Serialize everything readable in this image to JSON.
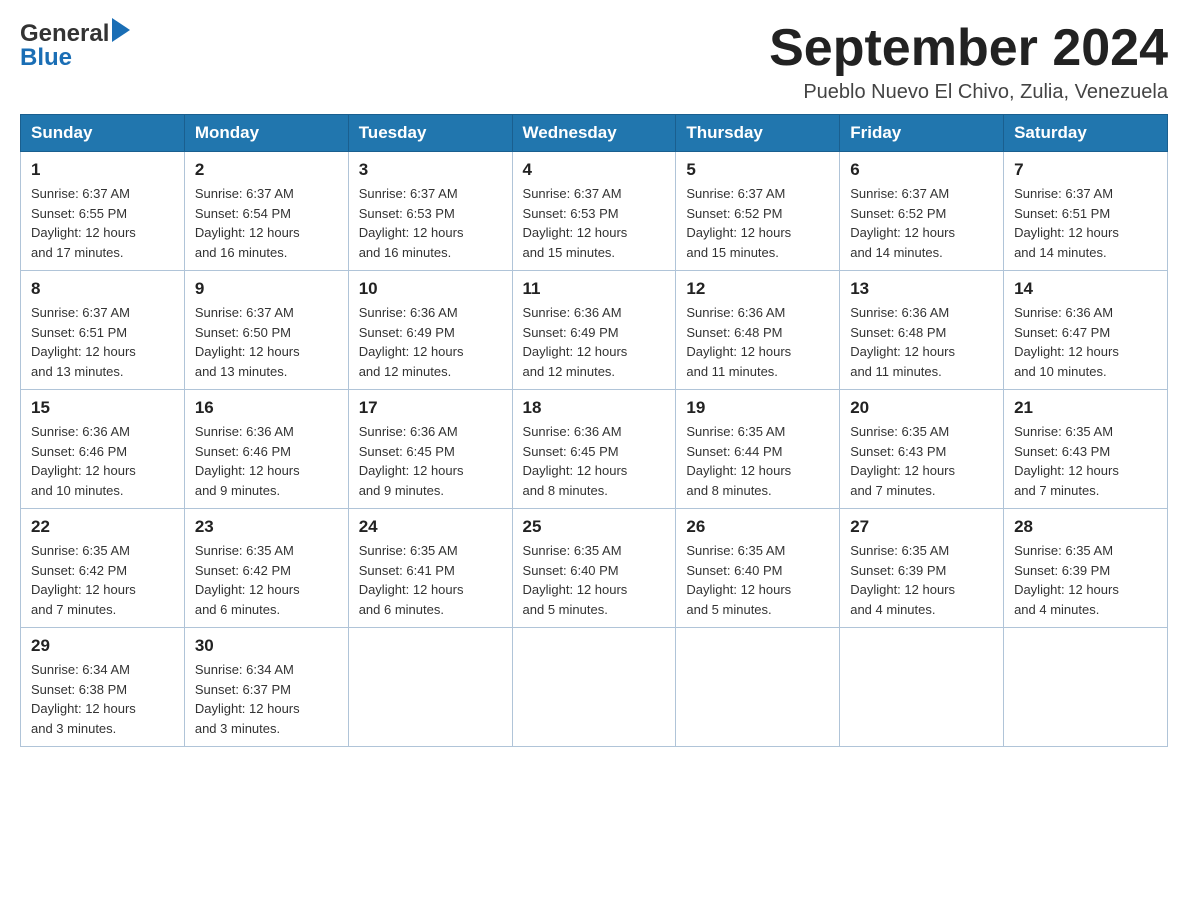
{
  "header": {
    "logo_general": "General",
    "logo_blue": "Blue",
    "title": "September 2024",
    "subtitle": "Pueblo Nuevo El Chivo, Zulia, Venezuela"
  },
  "columns": [
    "Sunday",
    "Monday",
    "Tuesday",
    "Wednesday",
    "Thursday",
    "Friday",
    "Saturday"
  ],
  "weeks": [
    [
      {
        "day": "1",
        "sunrise": "6:37 AM",
        "sunset": "6:55 PM",
        "daylight": "12 hours and 17 minutes."
      },
      {
        "day": "2",
        "sunrise": "6:37 AM",
        "sunset": "6:54 PM",
        "daylight": "12 hours and 16 minutes."
      },
      {
        "day": "3",
        "sunrise": "6:37 AM",
        "sunset": "6:53 PM",
        "daylight": "12 hours and 16 minutes."
      },
      {
        "day": "4",
        "sunrise": "6:37 AM",
        "sunset": "6:53 PM",
        "daylight": "12 hours and 15 minutes."
      },
      {
        "day": "5",
        "sunrise": "6:37 AM",
        "sunset": "6:52 PM",
        "daylight": "12 hours and 15 minutes."
      },
      {
        "day": "6",
        "sunrise": "6:37 AM",
        "sunset": "6:52 PM",
        "daylight": "12 hours and 14 minutes."
      },
      {
        "day": "7",
        "sunrise": "6:37 AM",
        "sunset": "6:51 PM",
        "daylight": "12 hours and 14 minutes."
      }
    ],
    [
      {
        "day": "8",
        "sunrise": "6:37 AM",
        "sunset": "6:51 PM",
        "daylight": "12 hours and 13 minutes."
      },
      {
        "day": "9",
        "sunrise": "6:37 AM",
        "sunset": "6:50 PM",
        "daylight": "12 hours and 13 minutes."
      },
      {
        "day": "10",
        "sunrise": "6:36 AM",
        "sunset": "6:49 PM",
        "daylight": "12 hours and 12 minutes."
      },
      {
        "day": "11",
        "sunrise": "6:36 AM",
        "sunset": "6:49 PM",
        "daylight": "12 hours and 12 minutes."
      },
      {
        "day": "12",
        "sunrise": "6:36 AM",
        "sunset": "6:48 PM",
        "daylight": "12 hours and 11 minutes."
      },
      {
        "day": "13",
        "sunrise": "6:36 AM",
        "sunset": "6:48 PM",
        "daylight": "12 hours and 11 minutes."
      },
      {
        "day": "14",
        "sunrise": "6:36 AM",
        "sunset": "6:47 PM",
        "daylight": "12 hours and 10 minutes."
      }
    ],
    [
      {
        "day": "15",
        "sunrise": "6:36 AM",
        "sunset": "6:46 PM",
        "daylight": "12 hours and 10 minutes."
      },
      {
        "day": "16",
        "sunrise": "6:36 AM",
        "sunset": "6:46 PM",
        "daylight": "12 hours and 9 minutes."
      },
      {
        "day": "17",
        "sunrise": "6:36 AM",
        "sunset": "6:45 PM",
        "daylight": "12 hours and 9 minutes."
      },
      {
        "day": "18",
        "sunrise": "6:36 AM",
        "sunset": "6:45 PM",
        "daylight": "12 hours and 8 minutes."
      },
      {
        "day": "19",
        "sunrise": "6:35 AM",
        "sunset": "6:44 PM",
        "daylight": "12 hours and 8 minutes."
      },
      {
        "day": "20",
        "sunrise": "6:35 AM",
        "sunset": "6:43 PM",
        "daylight": "12 hours and 7 minutes."
      },
      {
        "day": "21",
        "sunrise": "6:35 AM",
        "sunset": "6:43 PM",
        "daylight": "12 hours and 7 minutes."
      }
    ],
    [
      {
        "day": "22",
        "sunrise": "6:35 AM",
        "sunset": "6:42 PM",
        "daylight": "12 hours and 7 minutes."
      },
      {
        "day": "23",
        "sunrise": "6:35 AM",
        "sunset": "6:42 PM",
        "daylight": "12 hours and 6 minutes."
      },
      {
        "day": "24",
        "sunrise": "6:35 AM",
        "sunset": "6:41 PM",
        "daylight": "12 hours and 6 minutes."
      },
      {
        "day": "25",
        "sunrise": "6:35 AM",
        "sunset": "6:40 PM",
        "daylight": "12 hours and 5 minutes."
      },
      {
        "day": "26",
        "sunrise": "6:35 AM",
        "sunset": "6:40 PM",
        "daylight": "12 hours and 5 minutes."
      },
      {
        "day": "27",
        "sunrise": "6:35 AM",
        "sunset": "6:39 PM",
        "daylight": "12 hours and 4 minutes."
      },
      {
        "day": "28",
        "sunrise": "6:35 AM",
        "sunset": "6:39 PM",
        "daylight": "12 hours and 4 minutes."
      }
    ],
    [
      {
        "day": "29",
        "sunrise": "6:34 AM",
        "sunset": "6:38 PM",
        "daylight": "12 hours and 3 minutes."
      },
      {
        "day": "30",
        "sunrise": "6:34 AM",
        "sunset": "6:37 PM",
        "daylight": "12 hours and 3 minutes."
      },
      null,
      null,
      null,
      null,
      null
    ]
  ],
  "labels": {
    "sunrise": "Sunrise:",
    "sunset": "Sunset:",
    "daylight": "Daylight:"
  }
}
